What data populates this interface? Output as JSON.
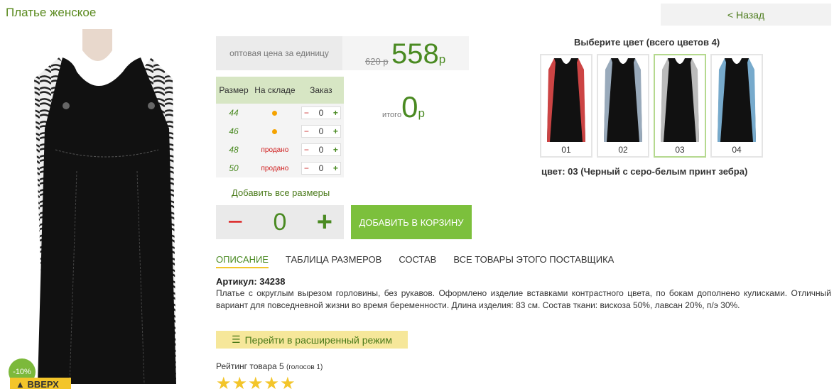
{
  "page": {
    "title": "Платье женское",
    "back_label": "< Назад"
  },
  "product_image": {
    "discount_badge": "-10%",
    "up_button": "ВВЕРХ"
  },
  "price": {
    "label": "оптовая цена за единицу",
    "old": "620 р",
    "new": "558",
    "currency": "р"
  },
  "sizes_table": {
    "headers": [
      "Размер",
      "На складе",
      "Заказ"
    ],
    "rows": [
      {
        "size": "44",
        "stock": "dot",
        "qty": "0"
      },
      {
        "size": "46",
        "stock": "dot",
        "qty": "0"
      },
      {
        "size": "48",
        "stock": "продано",
        "qty": "0"
      },
      {
        "size": "50",
        "stock": "продано",
        "qty": "0"
      }
    ]
  },
  "total": {
    "label": "итого",
    "value": "0",
    "currency": "р"
  },
  "add_all_sizes": "Добавить все размеры",
  "quantity": {
    "value": "0",
    "minus": "−",
    "plus": "+"
  },
  "cart_button": "ДОБАВИТЬ В КОРЗИНУ",
  "colors": {
    "title": "Выберите цвет (всего цветов 4)",
    "items": [
      "01",
      "02",
      "03",
      "04"
    ],
    "selected_label": "цвет: 03 (Черный с серо-белым принт зебра)"
  },
  "tabs": [
    "ОПИСАНИЕ",
    "ТАБЛИЦА РАЗМЕРОВ",
    "СОСТАВ",
    "ВСЕ ТОВАРЫ ЭТОГО ПОСТАВЩИКА"
  ],
  "article": "Артикул: 34238",
  "description": "Платье с округлым вырезом горловины, без рукавов. Оформлено изделие вставками контрастного цвета, по бокам дополнено кулисками. Отличный вариант для повседневной жизни во время беременности. Длина изделия: 83 см. Состав ткани: вискоза 50%, лавсан 20%, п/э 30%.",
  "advanced_mode": "Перейти в расширенный режим",
  "rating": {
    "text": "Рейтинг товара 5",
    "votes": "(голосов 1)",
    "stars": "★★★★★"
  },
  "colors_accent": {
    "green": "#4a8a22",
    "yellow": "#f3c52a"
  }
}
